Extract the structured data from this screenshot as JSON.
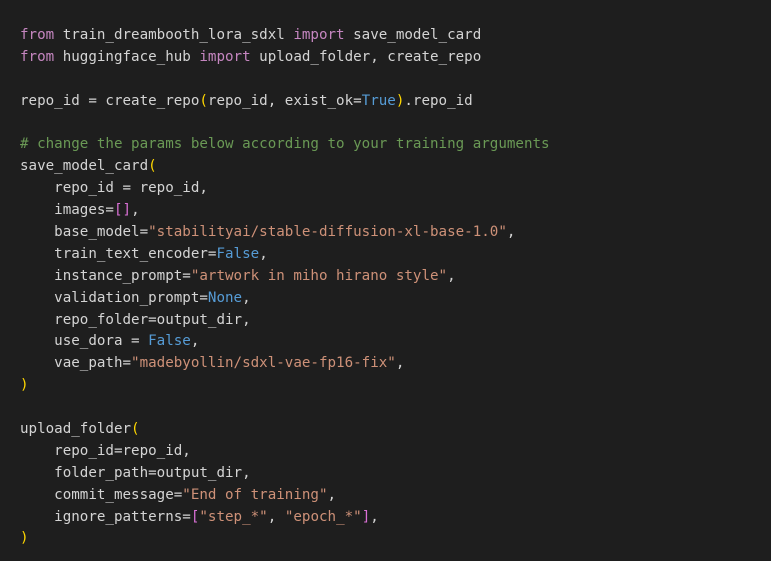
{
  "colors": {
    "background": "#1e1e1e",
    "plain": "#d4d4d4",
    "keyword": "#c586c0",
    "const": "#569cd6",
    "string": "#ce9178",
    "comment": "#6a9955",
    "paren": "#ffd700",
    "bracket": "#da70d6"
  },
  "code": {
    "lines": [
      [
        {
          "t": "keyword",
          "v": "from"
        },
        {
          "t": "plain",
          "v": " train_dreambooth_lora_sdxl "
        },
        {
          "t": "keyword",
          "v": "import"
        },
        {
          "t": "plain",
          "v": " save_model_card"
        }
      ],
      [
        {
          "t": "keyword",
          "v": "from"
        },
        {
          "t": "plain",
          "v": " huggingface_hub "
        },
        {
          "t": "keyword",
          "v": "import"
        },
        {
          "t": "plain",
          "v": " upload_folder, create_repo"
        }
      ],
      [],
      [
        {
          "t": "plain",
          "v": "repo_id = create_repo"
        },
        {
          "t": "paren",
          "v": "("
        },
        {
          "t": "plain",
          "v": "repo_id, exist_ok="
        },
        {
          "t": "const",
          "v": "True"
        },
        {
          "t": "paren",
          "v": ")"
        },
        {
          "t": "plain",
          "v": ".repo_id"
        }
      ],
      [],
      [
        {
          "t": "comment",
          "v": "# change the params below according to your training arguments"
        }
      ],
      [
        {
          "t": "plain",
          "v": "save_model_card"
        },
        {
          "t": "paren",
          "v": "("
        }
      ],
      [
        {
          "t": "plain",
          "v": "    repo_id = repo_id,"
        }
      ],
      [
        {
          "t": "plain",
          "v": "    images="
        },
        {
          "t": "bracket",
          "v": "[]"
        },
        {
          "t": "plain",
          "v": ","
        }
      ],
      [
        {
          "t": "plain",
          "v": "    base_model="
        },
        {
          "t": "string",
          "v": "\"stabilityai/stable-diffusion-xl-base-1.0\""
        },
        {
          "t": "plain",
          "v": ","
        }
      ],
      [
        {
          "t": "plain",
          "v": "    train_text_encoder="
        },
        {
          "t": "const",
          "v": "False"
        },
        {
          "t": "plain",
          "v": ","
        }
      ],
      [
        {
          "t": "plain",
          "v": "    instance_prompt="
        },
        {
          "t": "string",
          "v": "\"artwork in miho hirano style\""
        },
        {
          "t": "plain",
          "v": ","
        }
      ],
      [
        {
          "t": "plain",
          "v": "    validation_prompt="
        },
        {
          "t": "const",
          "v": "None"
        },
        {
          "t": "plain",
          "v": ","
        }
      ],
      [
        {
          "t": "plain",
          "v": "    repo_folder=output_dir,"
        }
      ],
      [
        {
          "t": "plain",
          "v": "    use_dora = "
        },
        {
          "t": "const",
          "v": "False"
        },
        {
          "t": "plain",
          "v": ","
        }
      ],
      [
        {
          "t": "plain",
          "v": "    vae_path="
        },
        {
          "t": "string",
          "v": "\"madebyollin/sdxl-vae-fp16-fix\""
        },
        {
          "t": "plain",
          "v": ","
        }
      ],
      [
        {
          "t": "paren",
          "v": ")"
        }
      ],
      [],
      [
        {
          "t": "plain",
          "v": "upload_folder"
        },
        {
          "t": "paren",
          "v": "("
        }
      ],
      [
        {
          "t": "plain",
          "v": "    repo_id=repo_id,"
        }
      ],
      [
        {
          "t": "plain",
          "v": "    folder_path=output_dir,"
        }
      ],
      [
        {
          "t": "plain",
          "v": "    commit_message="
        },
        {
          "t": "string",
          "v": "\"End of training\""
        },
        {
          "t": "plain",
          "v": ","
        }
      ],
      [
        {
          "t": "plain",
          "v": "    ignore_patterns="
        },
        {
          "t": "bracket",
          "v": "["
        },
        {
          "t": "string",
          "v": "\"step_*\""
        },
        {
          "t": "plain",
          "v": ", "
        },
        {
          "t": "string",
          "v": "\"epoch_*\""
        },
        {
          "t": "bracket",
          "v": "]"
        },
        {
          "t": "plain",
          "v": ","
        }
      ],
      [
        {
          "t": "paren",
          "v": ")"
        }
      ]
    ]
  }
}
